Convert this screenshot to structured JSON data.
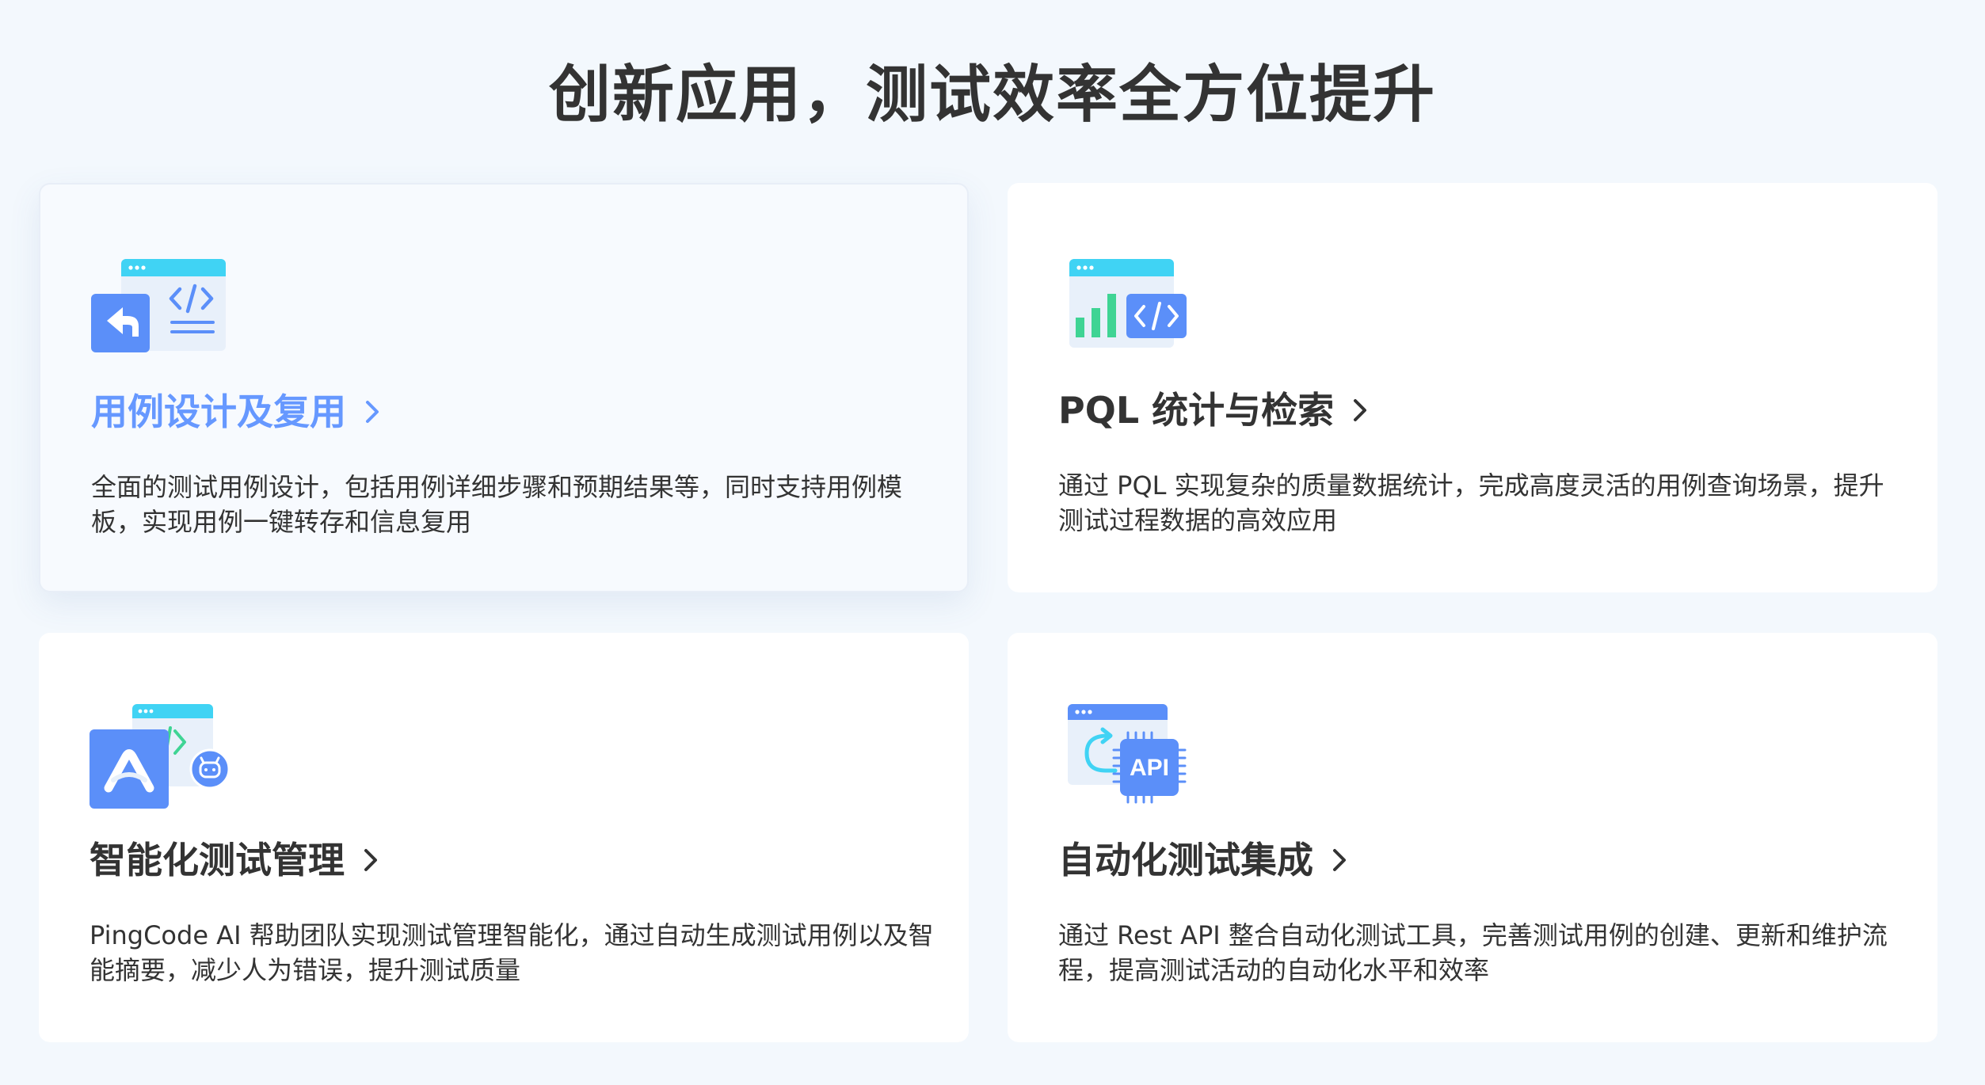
{
  "page": {
    "title": "创新应用，测试效率全方位提升"
  },
  "cards": [
    {
      "title": "用例设计及复用",
      "description": "全面的测试用例设计，包括用例详细步骤和预期结果等，同时支持用例模板，实现用例一键转存和信息复用",
      "icon": "test-case-reuse-icon",
      "active": true
    },
    {
      "title": "PQL 统计与检索",
      "description": "通过 PQL 实现复杂的质量数据统计，完成高度灵活的用例查询场景，提升测试过程数据的高效应用",
      "icon": "pql-stats-icon",
      "active": false
    },
    {
      "title": "智能化测试管理",
      "description": "PingCode AI 帮助团队实现测试管理智能化，通过自动生成测试用例以及智能摘要，减少人为错误，提升测试质量",
      "icon": "ai-test-icon",
      "active": false
    },
    {
      "title": "自动化测试集成",
      "description": "通过 Rest API 整合自动化测试工具，完善测试用例的创建、更新和维护流程，提高测试活动的自动化水平和效率",
      "icon": "api-integration-icon",
      "badge": "API",
      "active": false
    }
  ],
  "colors": {
    "background": "#f3f8fd",
    "accent_blue": "#6698ff",
    "icon_blue": "#5b8ff9",
    "icon_cyan": "#40d3f4",
    "icon_green": "#3fd494",
    "text": "#333333"
  }
}
